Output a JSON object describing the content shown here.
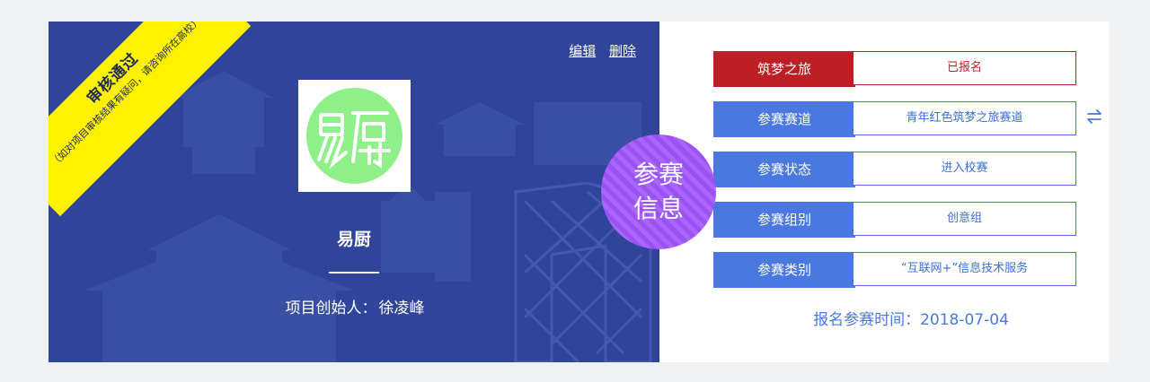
{
  "status": {
    "title": "审核通过",
    "note": "（如对项目审核结果有疑问，请咨询所在高校）",
    "color": "#fff200"
  },
  "actions": {
    "edit": "编辑",
    "delete": "删除"
  },
  "project": {
    "logo_text": "易厨",
    "logo_color": "#8ff08a",
    "name": "易厨",
    "founder_label": "项目创始人：",
    "founder": "徐凌峰"
  },
  "badge": {
    "line1": "参赛",
    "line2": "信息",
    "color": "#9a52f2"
  },
  "info": {
    "rows": [
      {
        "label": "筑梦之旅",
        "value": "已报名",
        "color": "#be1f24"
      },
      {
        "label": "参赛赛道",
        "value": "青年红色筑梦之旅赛道",
        "color": "#4a78e0"
      },
      {
        "label": "参赛状态",
        "value": "进入校赛",
        "color": "#4a78e0"
      },
      {
        "label": "参赛组别",
        "value": "创意组",
        "color": "#4a78e0"
      },
      {
        "label": "参赛类别",
        "value": "“互联网+”信息技术服务",
        "color": "#4a78e0"
      }
    ],
    "swap_icon": "swap-arrows-icon",
    "reg_time_label": "报名参赛时间：",
    "reg_time": "2018-07-04"
  },
  "theme": {
    "left_bg": "#30459a",
    "accent": "#4a78e0"
  }
}
